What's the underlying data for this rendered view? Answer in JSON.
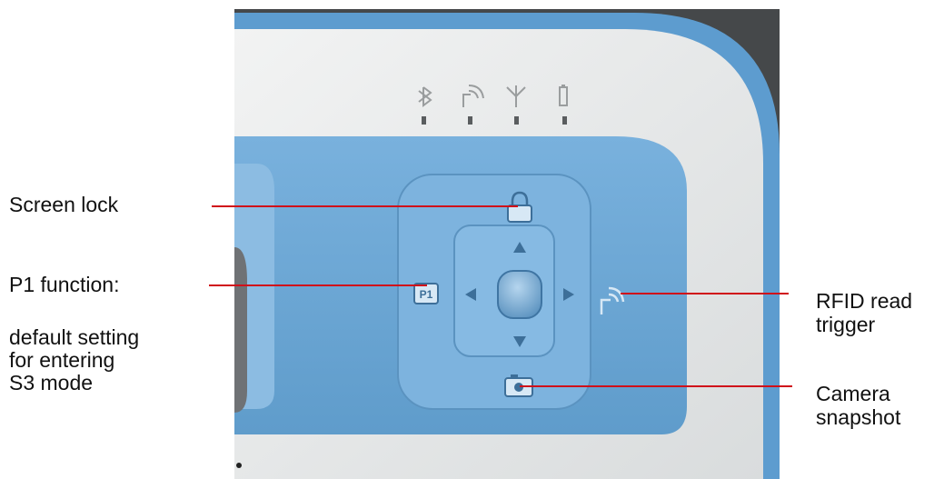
{
  "callouts": {
    "screen_lock": "Screen lock",
    "p1_title": "P1 function:",
    "p1_desc_1": "default setting",
    "p1_desc_2": "for entering",
    "p1_desc_3": "S3 mode",
    "rfid_1": "RFID read",
    "rfid_2": "trigger",
    "camera_1": "Camera",
    "camera_2": "snapshot"
  },
  "device": {
    "p1_key_label": "P1",
    "status_icons": [
      "bluetooth-icon",
      "rfid-icon",
      "antenna-icon",
      "battery-icon"
    ],
    "key_icons": [
      "lock-icon",
      "p1-key-icon",
      "rfid-key-icon",
      "camera-icon",
      "arrow-up-icon",
      "arrow-down-icon",
      "arrow-left-icon",
      "arrow-right-icon"
    ]
  },
  "colors": {
    "leader_line": "#d0101a",
    "keypad_blue": "#6fa7d4",
    "body_white": "#e8ebec",
    "background_dark": "#45484a"
  }
}
